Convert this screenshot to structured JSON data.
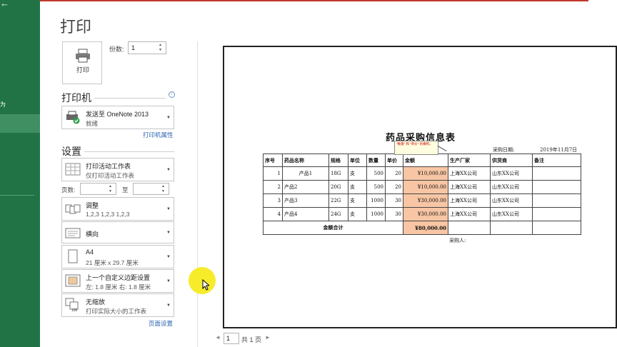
{
  "nav": {
    "back": "←",
    "item": "为"
  },
  "title": "打印",
  "print_button": {
    "label": "打印",
    "icon": "printer-icon"
  },
  "copies": {
    "label": "份数:",
    "value": "1"
  },
  "printer": {
    "section": "打印机",
    "name": "发送至 OneNote 2013",
    "status": "就绪",
    "properties_link": "打印机属性"
  },
  "settings": {
    "section": "设置",
    "scope": {
      "title": "打印活动工作表",
      "sub": "仅打印活动工作表"
    },
    "pages_label": "页数:",
    "to_label": "至",
    "collate": {
      "title": "调整",
      "sub": "1,2,3    1,2,3    1,2,3"
    },
    "orientation": {
      "title": "横向"
    },
    "paper": {
      "title": "A4",
      "sub": "21 厘米 x 29.7 厘米"
    },
    "margins": {
      "title": "上一个自定义边距设置",
      "sub": "左:  1.8 厘米    右:  1.8 厘米"
    },
    "scaling": {
      "title": "无缩放",
      "sub": "打印实际大小的工作表"
    },
    "page_setup_link": "页面设置"
  },
  "preview": {
    "sheet_title": "药品采购信息表",
    "date_label": "采购日期:",
    "date_value": "2019年11月7日",
    "comment": "\"数量\" 和 \"单价\" 的乘积。",
    "headers": [
      "序号",
      "药品名称",
      "规格",
      "单位",
      "数量",
      "单价",
      "金额",
      "生产厂家",
      "供货商",
      "备注"
    ],
    "rows": [
      [
        "1",
        "产品1",
        "18G",
        "支",
        "500",
        "20",
        "¥10,000.00",
        "上海XX公司",
        "山东XX公司",
        ""
      ],
      [
        "2",
        "产品2",
        "20G",
        "支",
        "500",
        "20",
        "¥10,000.00",
        "上海XX公司",
        "山东XX公司",
        ""
      ],
      [
        "3",
        "产品3",
        "22G",
        "支",
        "1000",
        "30",
        "¥30,000.00",
        "上海XX公司",
        "山东XX公司",
        ""
      ],
      [
        "4",
        "产品4",
        "24G",
        "支",
        "1000",
        "30",
        "¥30,000.00",
        "上海XX公司",
        "山东XX公司",
        ""
      ]
    ],
    "total_label": "金额合计",
    "total_value": "¥80,000.00",
    "buyer_label": "采购人:"
  },
  "page_nav": {
    "current": "1",
    "total": "共 1 页",
    "prev": "◄",
    "next": "►"
  },
  "colors": {
    "nav_bg": "#217346",
    "amount_fill": "#f8c6a4",
    "link": "#2e65b0"
  }
}
